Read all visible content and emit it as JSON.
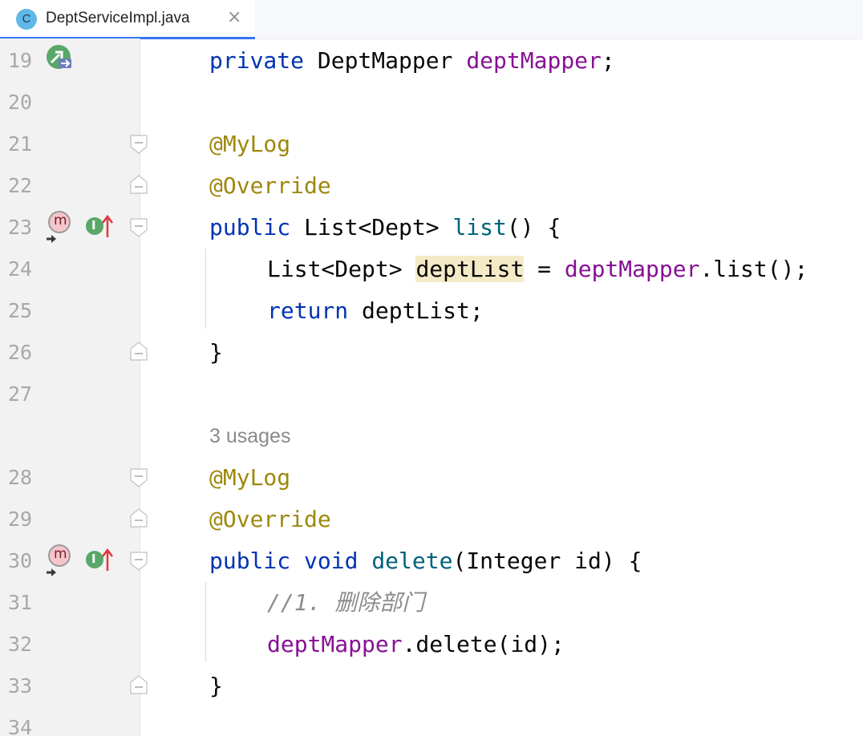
{
  "tab": {
    "icon_letter": "C",
    "title": "DeptServiceImpl.java",
    "close": "×"
  },
  "gutter_icons": {
    "method_badge": "m",
    "impl_badge": "I"
  },
  "lines": {
    "n19": "19",
    "n20": "20",
    "n21": "21",
    "n22": "22",
    "n23": "23",
    "n24": "24",
    "n25": "25",
    "n26": "26",
    "n27": "27",
    "n28": "28",
    "n29": "29",
    "n30": "30",
    "n31": "31",
    "n32": "32",
    "n33": "33",
    "n34": "34"
  },
  "code": {
    "l19": {
      "kw": "private",
      "type": " DeptMapper ",
      "field": "deptMapper",
      "end": ";"
    },
    "l21": {
      "ann": "@MyLog"
    },
    "l22": {
      "ann": "@Override"
    },
    "l23": {
      "kw": "public",
      "type": " List<Dept> ",
      "fn": "list",
      "end": "() {"
    },
    "l24": {
      "type": "List<Dept> ",
      "var": "deptList",
      "mid": " = ",
      "field": "deptMapper",
      "end": ".list();"
    },
    "l25": {
      "kw": "return",
      "end": " deptList;"
    },
    "l26": {
      "end": "}"
    },
    "usages": "3 usages",
    "l28": {
      "ann": "@MyLog"
    },
    "l29": {
      "ann": "@Override"
    },
    "l30": {
      "kw": "public",
      "kw2": " void ",
      "fn": "delete",
      "end": "(Integer id) {"
    },
    "l31": {
      "cmt": "//1. 删除部门"
    },
    "l32": {
      "field": "deptMapper",
      "end": ".delete(id);"
    },
    "l33": {
      "end": "}"
    }
  }
}
